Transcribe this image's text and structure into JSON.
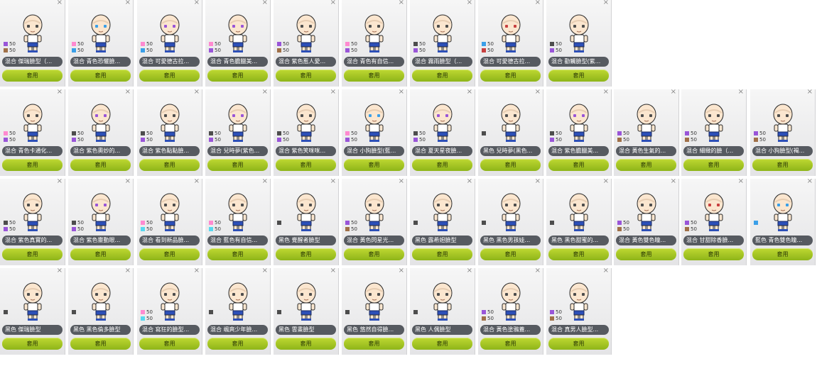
{
  "ui": {
    "close_glyph": "×",
    "apply_label": "套用",
    "accent": "#a4c824",
    "name_bar": "#565a60"
  },
  "colors": {
    "pink": "#ff8ad0",
    "brown": "#a07048",
    "blue": "#3a9fe8",
    "purple": "#9955d8",
    "dark": "#4d4d4d",
    "cyan": "#58d8f0",
    "gold": "#d4a030",
    "red": "#c84040"
  },
  "cards": [
    {
      "name": "混合 傑瑞臉型（...",
      "swatches": [
        {
          "color": "purple",
          "value": "50"
        },
        {
          "color": "brown",
          "value": "50"
        }
      ],
      "eye": "dark"
    },
    {
      "name": "混合 青色恐懼臉...",
      "swatches": [
        {
          "color": "pink",
          "value": "50"
        },
        {
          "color": "blue",
          "value": "50"
        }
      ],
      "eye": "blue"
    },
    {
      "name": "混合 可愛德古拉...",
      "swatches": [
        {
          "color": "pink",
          "value": "50"
        },
        {
          "color": "blue",
          "value": "50"
        }
      ],
      "eye": "purple"
    },
    {
      "name": "混合 青色膽臘美...",
      "swatches": [
        {
          "color": "pink",
          "value": "50"
        },
        {
          "color": "purple",
          "value": "50"
        }
      ],
      "eye": "purple"
    },
    {
      "name": "混合 紫色惹人愛...",
      "swatches": [
        {
          "color": "purple",
          "value": "50"
        },
        {
          "color": "brown",
          "value": "50"
        }
      ],
      "eye": "dark"
    },
    {
      "name": "混合 青色有自信...",
      "swatches": [
        {
          "color": "pink",
          "value": "50"
        },
        {
          "color": "purple",
          "value": "50"
        }
      ],
      "eye": "dark"
    },
    {
      "name": "混合 霧雨臉型（...",
      "swatches": [
        {
          "color": "dark",
          "value": "50"
        },
        {
          "color": "purple",
          "value": "50"
        }
      ],
      "eye": "dark"
    },
    {
      "name": "混合 可愛德古拉...",
      "swatches": [
        {
          "color": "blue",
          "value": "50"
        },
        {
          "color": "red",
          "value": "50"
        }
      ],
      "eye": "red"
    },
    {
      "name": "混合 勸觸臉型(紫...",
      "swatches": [
        {
          "color": "dark",
          "value": "50"
        },
        {
          "color": "purple",
          "value": "50"
        }
      ],
      "eye": "dark"
    },
    {
      "name": "混合 青色卡通化...",
      "swatches": [
        {
          "color": "pink",
          "value": "50"
        },
        {
          "color": "purple",
          "value": "50"
        }
      ],
      "eye": "dark"
    },
    {
      "name": "混合 紫色奧妙的...",
      "swatches": [
        {
          "color": "dark",
          "value": "50"
        },
        {
          "color": "purple",
          "value": "50"
        }
      ],
      "eye": "purple"
    },
    {
      "name": "混合 紫色點點臉...",
      "swatches": [
        {
          "color": "dark",
          "value": "50"
        },
        {
          "color": "purple",
          "value": "50"
        }
      ],
      "eye": "dark"
    },
    {
      "name": "混合 兒時夢(紫色...",
      "swatches": [
        {
          "color": "dark",
          "value": "50"
        },
        {
          "color": "purple",
          "value": "50"
        }
      ],
      "eye": "purple"
    },
    {
      "name": "混合 紫色笑咪咪...",
      "swatches": [
        {
          "color": "dark",
          "value": "50"
        },
        {
          "color": "purple",
          "value": "50"
        }
      ],
      "eye": "dark"
    },
    {
      "name": "混合 小狗臉型(藍...",
      "swatches": [
        {
          "color": "pink",
          "value": "50"
        },
        {
          "color": "purple",
          "value": "50"
        }
      ],
      "eye": "blue"
    },
    {
      "name": "混合 夏天星夜臉...",
      "swatches": [
        {
          "color": "dark",
          "value": "50"
        },
        {
          "color": "purple",
          "value": "50"
        }
      ],
      "eye": "purple"
    },
    {
      "name": "黑色 兒時夢(黑色...",
      "swatches": [
        {
          "color": "dark",
          "value": ""
        }
      ],
      "eye": "dark"
    },
    {
      "name": "混合 紫色膽臘美...",
      "swatches": [
        {
          "color": "dark",
          "value": "50"
        },
        {
          "color": "purple",
          "value": "50"
        }
      ],
      "eye": "purple"
    },
    {
      "name": "混合 黃色生氣的...",
      "swatches": [
        {
          "color": "purple",
          "value": "50"
        },
        {
          "color": "brown",
          "value": "50"
        }
      ],
      "eye": "dark"
    },
    {
      "name": "混合 細緻的臉（...",
      "swatches": [
        {
          "color": "purple",
          "value": "50"
        },
        {
          "color": "brown",
          "value": "50"
        }
      ],
      "eye": "dark"
    },
    {
      "name": "混合 小狗臉型(褐...",
      "swatches": [
        {
          "color": "purple",
          "value": "50"
        },
        {
          "color": "brown",
          "value": "50"
        }
      ],
      "eye": "dark"
    },
    {
      "name": "混合 紫色真實的...",
      "swatches": [
        {
          "color": "dark",
          "value": "50"
        },
        {
          "color": "purple",
          "value": "50"
        }
      ],
      "eye": "dark"
    },
    {
      "name": "混合 紫色靈動眼...",
      "swatches": [
        {
          "color": "dark",
          "value": "50"
        },
        {
          "color": "purple",
          "value": "50"
        }
      ],
      "eye": "purple"
    },
    {
      "name": "混合 看到新品臉...",
      "swatches": [
        {
          "color": "pink",
          "value": "50"
        },
        {
          "color": "cyan",
          "value": "50"
        }
      ],
      "eye": "dark"
    },
    {
      "name": "混合 藍色有自信...",
      "swatches": [
        {
          "color": "pink",
          "value": "50"
        },
        {
          "color": "cyan",
          "value": "50"
        }
      ],
      "eye": "dark"
    },
    {
      "name": "黑色 覺醒者臉型",
      "swatches": [
        {
          "color": "dark",
          "value": ""
        }
      ],
      "eye": "dark"
    },
    {
      "name": "混合 黃色閃星光...",
      "swatches": [
        {
          "color": "purple",
          "value": "50"
        },
        {
          "color": "brown",
          "value": "50"
        }
      ],
      "eye": "dark"
    },
    {
      "name": "黑色 露希妲臉型",
      "swatches": [
        {
          "color": "dark",
          "value": ""
        }
      ],
      "eye": "dark"
    },
    {
      "name": "黑色 黑色男孩娃...",
      "swatches": [
        {
          "color": "dark",
          "value": ""
        }
      ],
      "eye": "dark"
    },
    {
      "name": "黑色 黑色甜蜜的...",
      "swatches": [
        {
          "color": "dark",
          "value": ""
        }
      ],
      "eye": "dark"
    },
    {
      "name": "混合 黃色雙色瞳...",
      "swatches": [
        {
          "color": "purple",
          "value": "50"
        },
        {
          "color": "brown",
          "value": "50"
        }
      ],
      "eye": "dark"
    },
    {
      "name": "混合 甘甜除香臉...",
      "swatches": [
        {
          "color": "purple",
          "value": "50"
        },
        {
          "color": "brown",
          "value": "50"
        }
      ],
      "eye": "red"
    },
    {
      "name": "藍色 青色雙色瞳...",
      "swatches": [
        {
          "color": "blue",
          "value": ""
        }
      ],
      "eye": "blue"
    },
    {
      "name": "黑色 傑瑞臉型",
      "swatches": [
        {
          "color": "dark",
          "value": ""
        }
      ],
      "eye": "dark"
    },
    {
      "name": "黑色 黑色倫多臉型",
      "swatches": [
        {
          "color": "dark",
          "value": ""
        }
      ],
      "eye": "dark"
    },
    {
      "name": "混合 寫狂的臉型...",
      "swatches": [
        {
          "color": "pink",
          "value": "50"
        },
        {
          "color": "cyan",
          "value": "50"
        }
      ],
      "eye": "dark"
    },
    {
      "name": "混合 颯爽少年臉...",
      "swatches": [
        {
          "color": "dark",
          "value": ""
        }
      ],
      "eye": "dark"
    },
    {
      "name": "黑色 雲畫臉型",
      "swatches": [
        {
          "color": "dark",
          "value": ""
        }
      ],
      "eye": "dark"
    },
    {
      "name": "黑色 悠然自得臉...",
      "swatches": [
        {
          "color": "dark",
          "value": ""
        }
      ],
      "eye": "dark"
    },
    {
      "name": "黑色 人偶臉型",
      "swatches": [
        {
          "color": "dark",
          "value": ""
        }
      ],
      "eye": "dark"
    },
    {
      "name": "混合 黃色塗鴉蓋...",
      "swatches": [
        {
          "color": "purple",
          "value": "50"
        },
        {
          "color": "brown",
          "value": "50"
        }
      ],
      "eye": "dark"
    },
    {
      "name": "混合 真男人臉型...",
      "swatches": [
        {
          "color": "purple",
          "value": "50"
        },
        {
          "color": "brown",
          "value": "50"
        }
      ],
      "eye": "dark"
    }
  ]
}
